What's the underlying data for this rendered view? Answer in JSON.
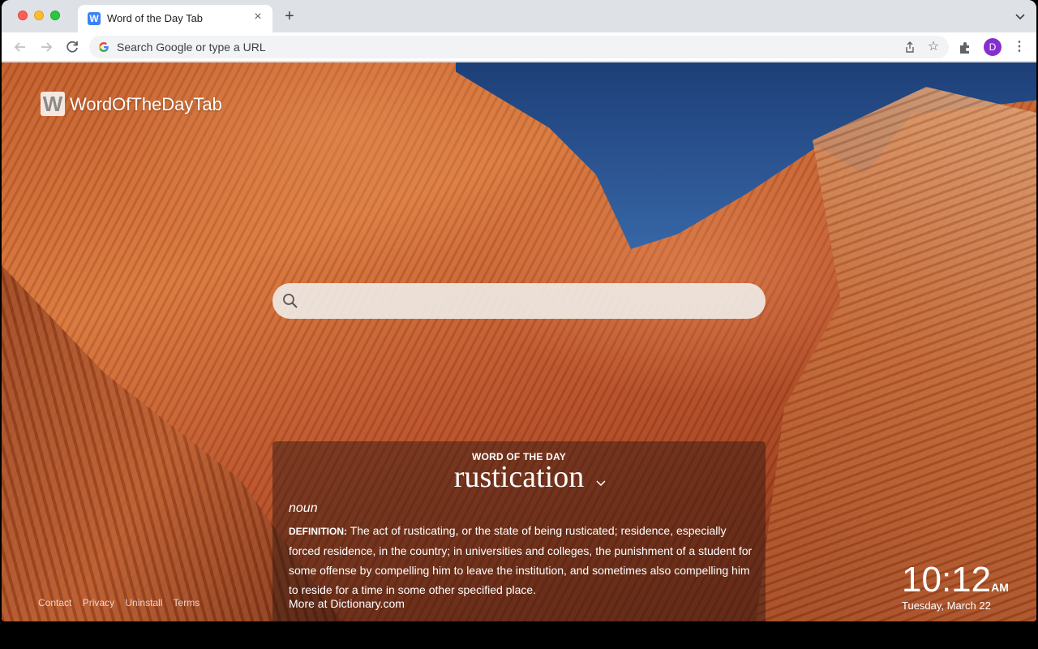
{
  "browser": {
    "tab_title": "Word of the Day Tab",
    "tab_favicon_letter": "W",
    "omnibox_placeholder": "Search Google or type a URL",
    "avatar_letter": "D",
    "new_tab": "+",
    "close": "×"
  },
  "brand": {
    "logo_letter": "W",
    "name": "WordOfTheDayTab"
  },
  "search": {
    "placeholder": ""
  },
  "word_of_the_day": {
    "kicker": "WORD OF THE DAY",
    "word": "rustication",
    "part_of_speech": "noun",
    "definition_label": "DEFINITION:",
    "definition": "The act of rusticating, or the state of being rusticated; residence, especially forced residence, in the country; in universities and colleges, the punishment of a student for some offense by compelling him to leave the institution, and sometimes also compelling him to reside for a time in some other specified place.",
    "more": "More at Dictionary.com"
  },
  "footer_links": [
    "Contact",
    "Privacy",
    "Uninstall",
    "Terms"
  ],
  "clock": {
    "time": "10:12",
    "ampm": "AM",
    "date": "Tuesday, March 22"
  },
  "colors": {
    "avatar": "#8430ce",
    "accent_blue": "#3b82f6"
  }
}
